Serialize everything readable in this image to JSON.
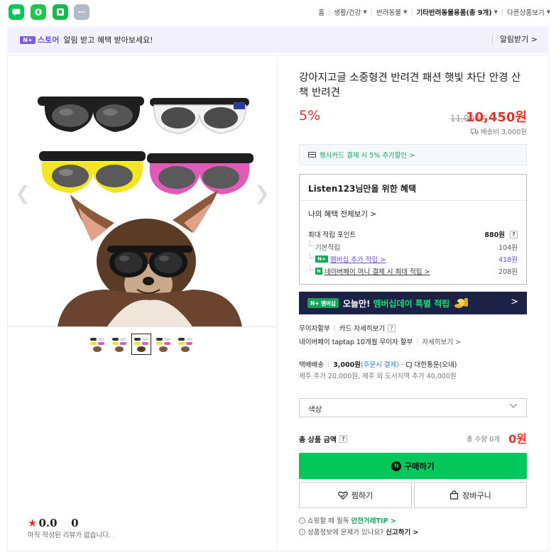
{
  "share_buttons": [
    {
      "icon": "naver-talk-icon",
      "color": "#03c75a"
    },
    {
      "icon": "band-icon",
      "color": "#20c54d"
    },
    {
      "icon": "bookmark-icon",
      "color": "#18b94b"
    },
    {
      "icon": "more-icon",
      "color": "#b4bac4"
    }
  ],
  "breadcrumb": {
    "home": "홈",
    "items": [
      "생활/건강",
      "반려동물",
      "기타반려동물용품(총 9개)",
      "다른상품보기"
    ]
  },
  "store_notice": {
    "logo_box": "N+",
    "logo_text": "스토어",
    "message": "알림 받고 혜택 받아보세요!",
    "action": "알림받기 >"
  },
  "product": {
    "title": "강아지고글 소중형견 반려견 패션 햇빛 차단 안경 산책 반려견",
    "discount": "5%",
    "original_price": "11,000원",
    "sale_price": "10,450원",
    "shipping_fee": "배송비 3,000원"
  },
  "card_promo": "행사카드 결제 시 5% 추가할인 >",
  "benefits": {
    "heading": "Listen123님만을 위한 혜택",
    "view_all": "나의 혜택 전체보기 >",
    "max_points_label": "최대 적립 포인트",
    "max_points_value": "880원",
    "basic_label": "기본적립",
    "basic_value": "104원",
    "membership_badge": "N+",
    "membership_label": "멤버십 추가 적립 >",
    "membership_value": "418원",
    "pay_badge": "N",
    "pay_label": "네이버페이 머니 결제 시 최대 적립 >",
    "pay_value": "208원"
  },
  "membership_banner": {
    "badge": "N+ 멤버십",
    "text": "오늘만!",
    "highlight": "멤버십데이 특별 적립",
    "arrow": ">"
  },
  "installment": {
    "label": "무이자할부",
    "card_detail": "카드 자세히보기",
    "pay_info": "네이버페이 taptap 10개월 무이자 할부",
    "pay_detail": "자세히보기 >"
  },
  "shipping": {
    "type": "택배배송",
    "fee": "3,000원",
    "prepay": "(주문시 결제)",
    "carrier": "· CJ 대한통운(오네)",
    "extra": "제주 추가 20,000원, 제주 외 도서지역 추가 40,000원"
  },
  "option_select": {
    "placeholder": "색상"
  },
  "total": {
    "label": "총 상품 금액",
    "qty": "총 수량 0개",
    "amount": "0원"
  },
  "buttons": {
    "buy_icon": "N",
    "buy": "구매하기",
    "wish": "찜하기",
    "cart": "장바구니"
  },
  "footer": {
    "tip_prefix": "쇼핑할 때 필독",
    "tip_link": "안전거래TIP >",
    "report_prefix": "상품정보에 문제가 있나요?",
    "report_link": "신고하기 >"
  },
  "gallery": {
    "prev": "❮",
    "next": "❯",
    "thumb_count": 5,
    "active_index": 2,
    "goggle_colors": [
      "#2a2a2a",
      "#f4f4f4",
      "#f3e51f",
      "#e05ab8"
    ]
  },
  "reviews": {
    "star": "★",
    "score": "0.0",
    "count": "0",
    "empty_text": "아직 작성된 리뷰가 없습니다."
  },
  "colors": {
    "accent_red": "#e5322d",
    "naver_green": "#03c75a",
    "purple": "#6a4be0",
    "banner_navy": "#1c2145"
  }
}
